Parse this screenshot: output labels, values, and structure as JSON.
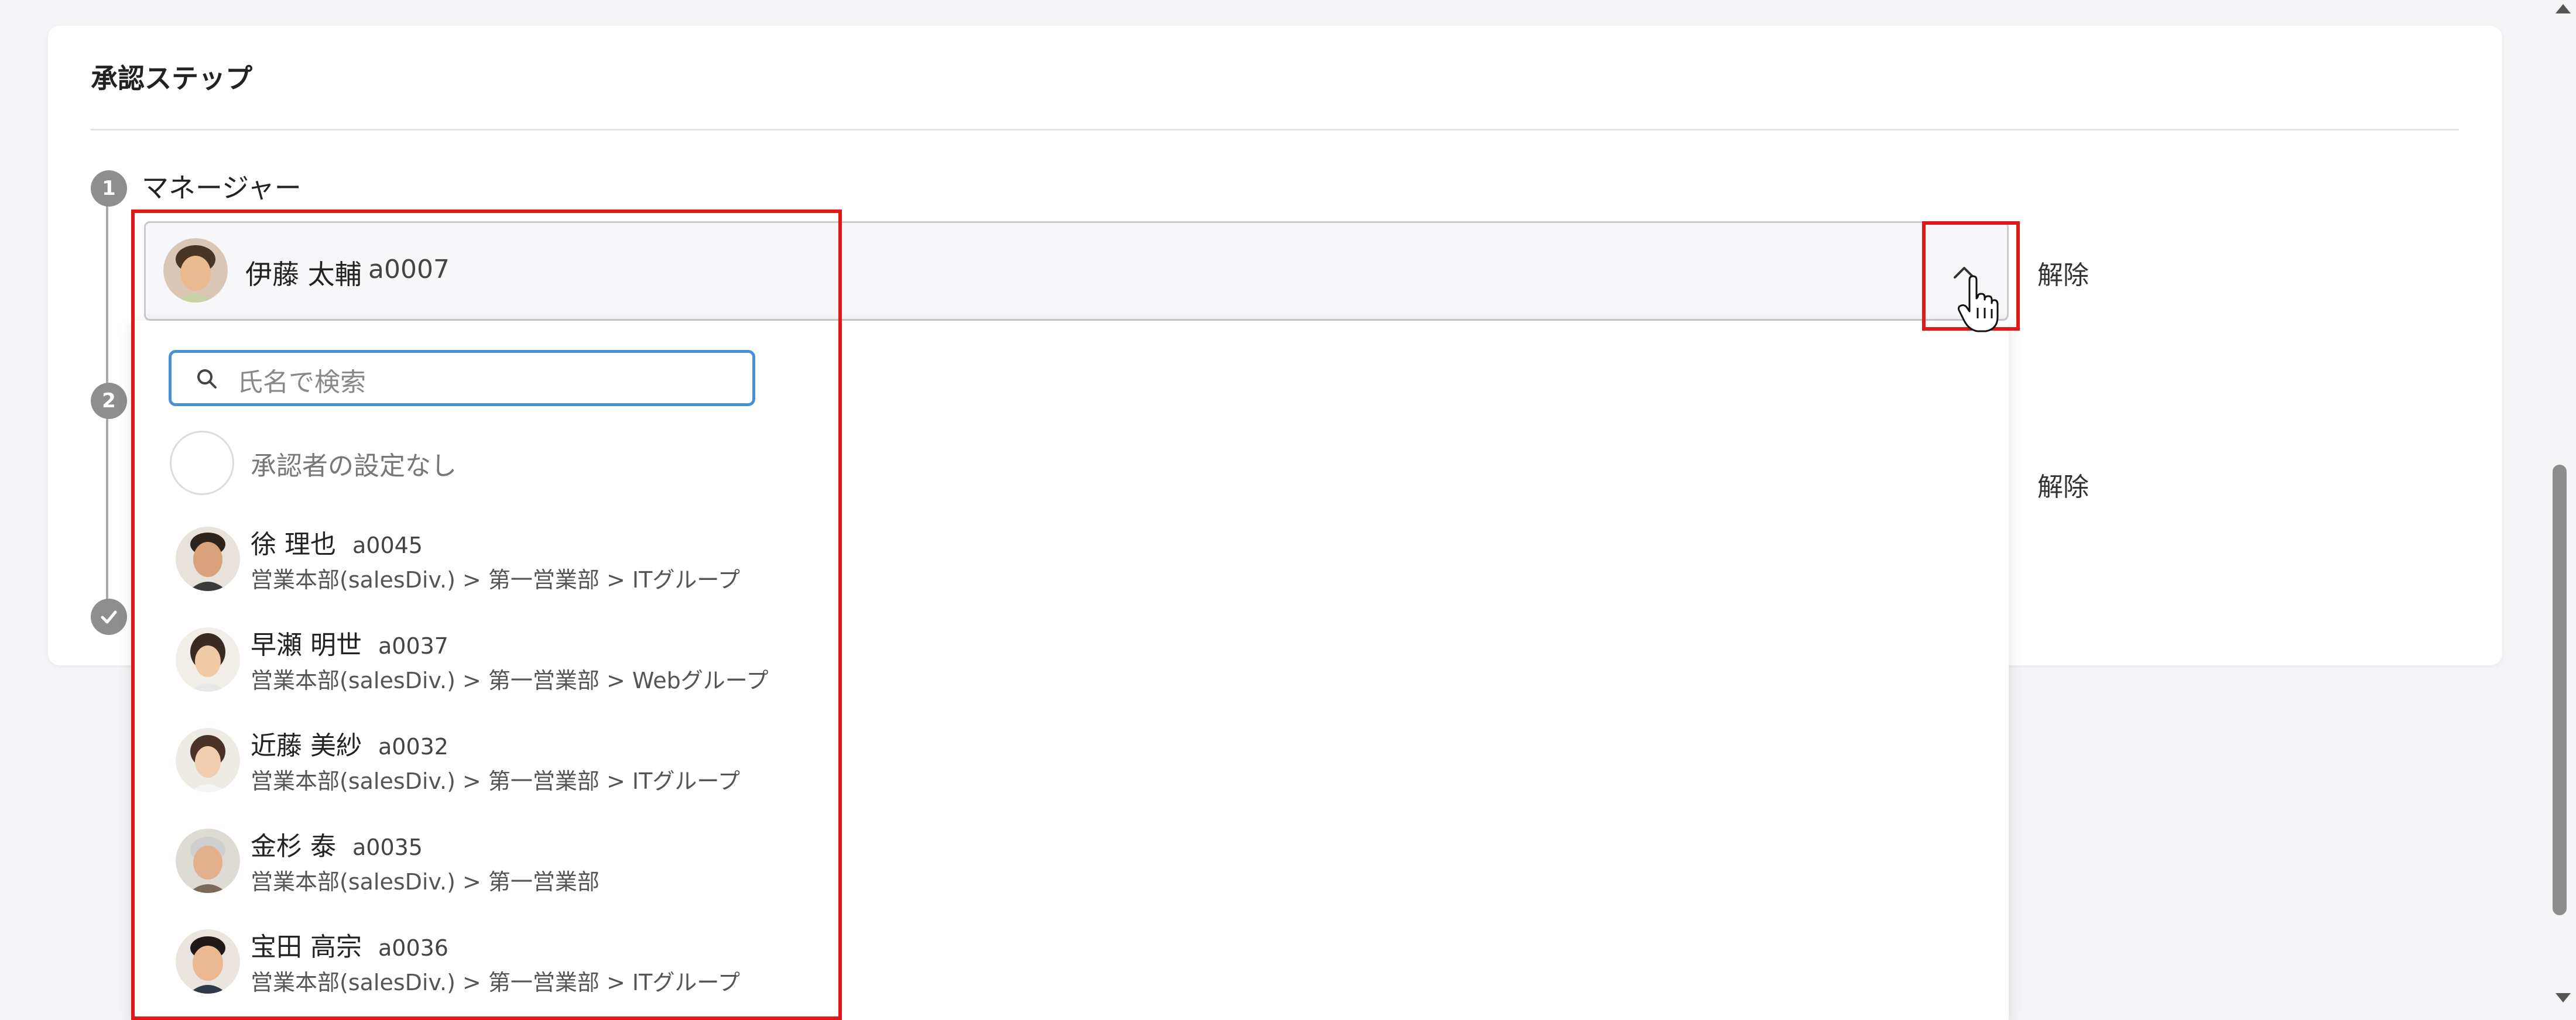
{
  "card": {
    "title": "承認ステップ"
  },
  "steps": [
    {
      "number": "1",
      "label": "マネージャー",
      "remove_label": "解除"
    },
    {
      "number": "2",
      "label": "",
      "remove_label": "解除"
    }
  ],
  "selector": {
    "selected_name": "伊藤 太輔",
    "selected_code": "a0007"
  },
  "dropdown": {
    "search_placeholder": "氏名で検索",
    "none_option": "承認者の設定なし",
    "options": [
      {
        "name": "徐 理也",
        "code": "a0045",
        "path": "営業本部(salesDiv.) > 第一営業部 > ITグループ"
      },
      {
        "name": "早瀬 明世",
        "code": "a0037",
        "path": "営業本部(salesDiv.) > 第一営業部 > Webグループ"
      },
      {
        "name": "近藤 美紗",
        "code": "a0032",
        "path": "営業本部(salesDiv.) > 第一営業部 > ITグループ"
      },
      {
        "name": "金杉 泰",
        "code": "a0035",
        "path": "営業本部(salesDiv.) > 第一営業部"
      },
      {
        "name": "宝田 高宗",
        "code": "a0036",
        "path": "営業本部(salesDiv.) > 第一営業部 > ITグループ"
      }
    ]
  },
  "colors": {
    "highlight": "#e01818",
    "focus": "#4a90d9",
    "step_badge": "#8e8e8e"
  },
  "icons": [
    "chevron-up-icon",
    "search-icon",
    "check-icon",
    "hand-cursor-icon"
  ]
}
